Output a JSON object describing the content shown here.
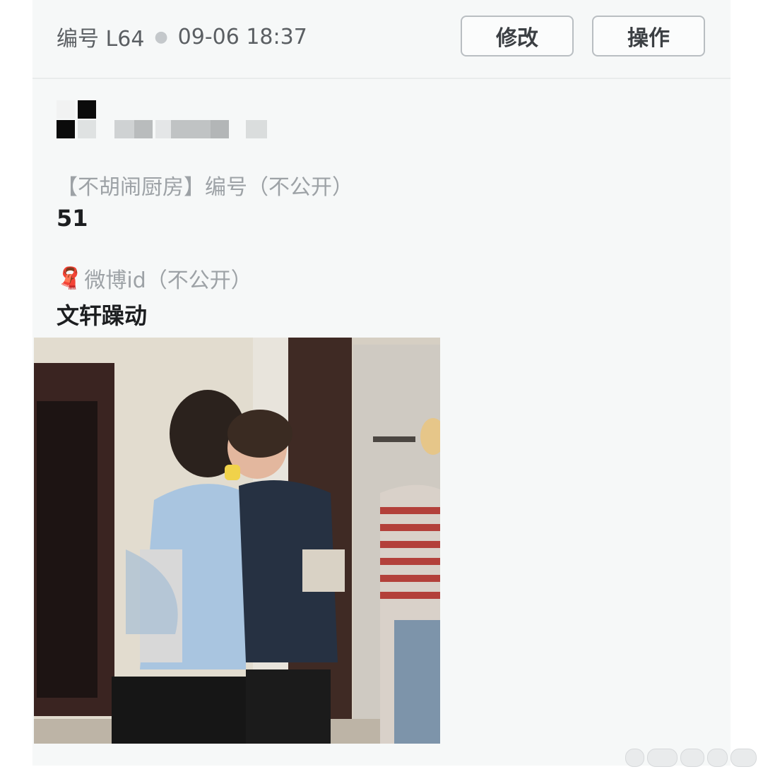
{
  "header": {
    "id_label": "编号 L64",
    "timestamp": "09-06 18:37",
    "edit_button": "修改",
    "action_button": "操作"
  },
  "fields": [
    {
      "label": "【不胡闹厨房】编号（不公开）",
      "value": "51"
    },
    {
      "icon": "🧣",
      "label": "微博id（不公开）",
      "value": "文轩躁动"
    }
  ],
  "colors": {
    "card_background": "#f6f8f8",
    "label_gray": "#9da2a6",
    "value_black": "#1c1e20",
    "button_border": "#b9bec2"
  }
}
